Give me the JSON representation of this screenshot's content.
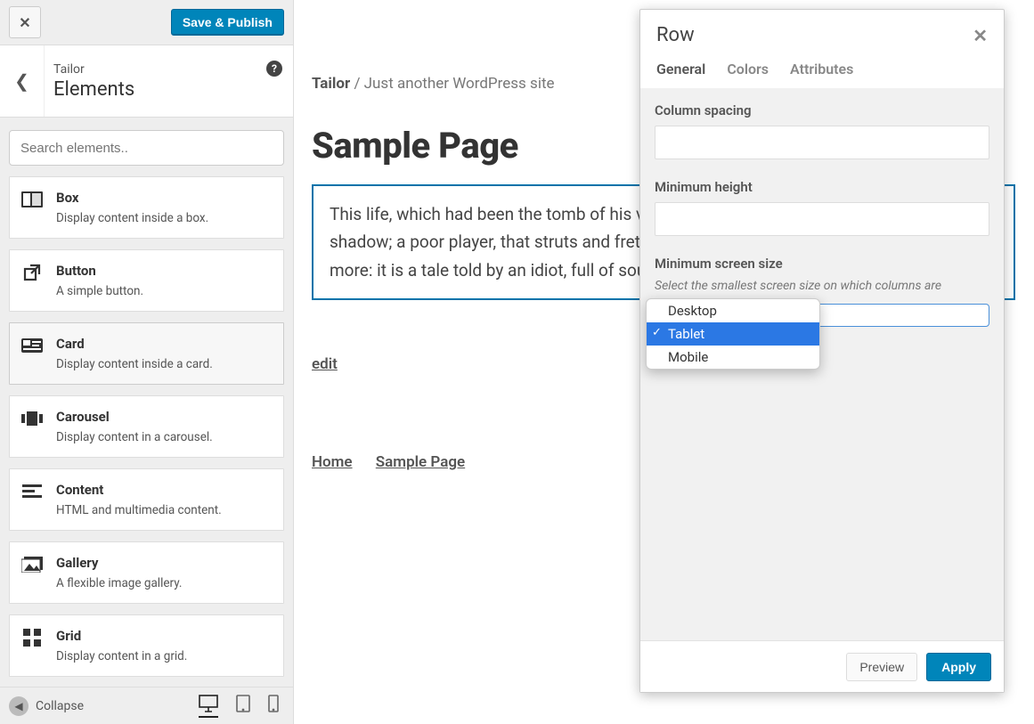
{
  "header": {
    "save_label": "Save & Publish"
  },
  "sidebar": {
    "sup_title": "Tailor",
    "title": "Elements",
    "search_placeholder": "Search elements..",
    "collapse_label": "Collapse",
    "items": [
      {
        "name": "Box",
        "desc": "Display content inside a box.",
        "icon": "box-icon"
      },
      {
        "name": "Button",
        "desc": "A simple button.",
        "icon": "external-icon"
      },
      {
        "name": "Card",
        "desc": "Display content inside a card.",
        "icon": "card-icon",
        "selected": true
      },
      {
        "name": "Carousel",
        "desc": "Display content in a carousel.",
        "icon": "carousel-icon"
      },
      {
        "name": "Content",
        "desc": "HTML and multimedia content.",
        "icon": "content-icon"
      },
      {
        "name": "Gallery",
        "desc": "A flexible image gallery.",
        "icon": "gallery-icon"
      },
      {
        "name": "Grid",
        "desc": "Display content in a grid.",
        "icon": "grid-icon"
      }
    ]
  },
  "content": {
    "breadcrumb_site": "Tailor",
    "breadcrumb_tag": "Just another WordPress site",
    "page_title": "Sample Page",
    "paragraph": "This life, which had been the tomb of his virtue and of his honour, is but a walking shadow; a poor player, that struts and frets his hour upon the stage, and then is heard no more: it is a tale told by an idiot, full of sound and fury, signifying nothing.",
    "edit_label": "edit",
    "footer_links": [
      "Home",
      "Sample Page"
    ]
  },
  "panel": {
    "title": "Row",
    "tabs": [
      "General",
      "Colors",
      "Attributes"
    ],
    "active_tab": "General",
    "fields": {
      "column_spacing_label": "Column spacing",
      "min_height_label": "Minimum height",
      "min_screen_label": "Minimum screen size",
      "min_screen_help": "Select the smallest screen size on which columns are",
      "screen_options": [
        "Desktop",
        "Tablet",
        "Mobile"
      ],
      "screen_selected": "Tablet"
    },
    "preview_label": "Preview",
    "apply_label": "Apply"
  }
}
